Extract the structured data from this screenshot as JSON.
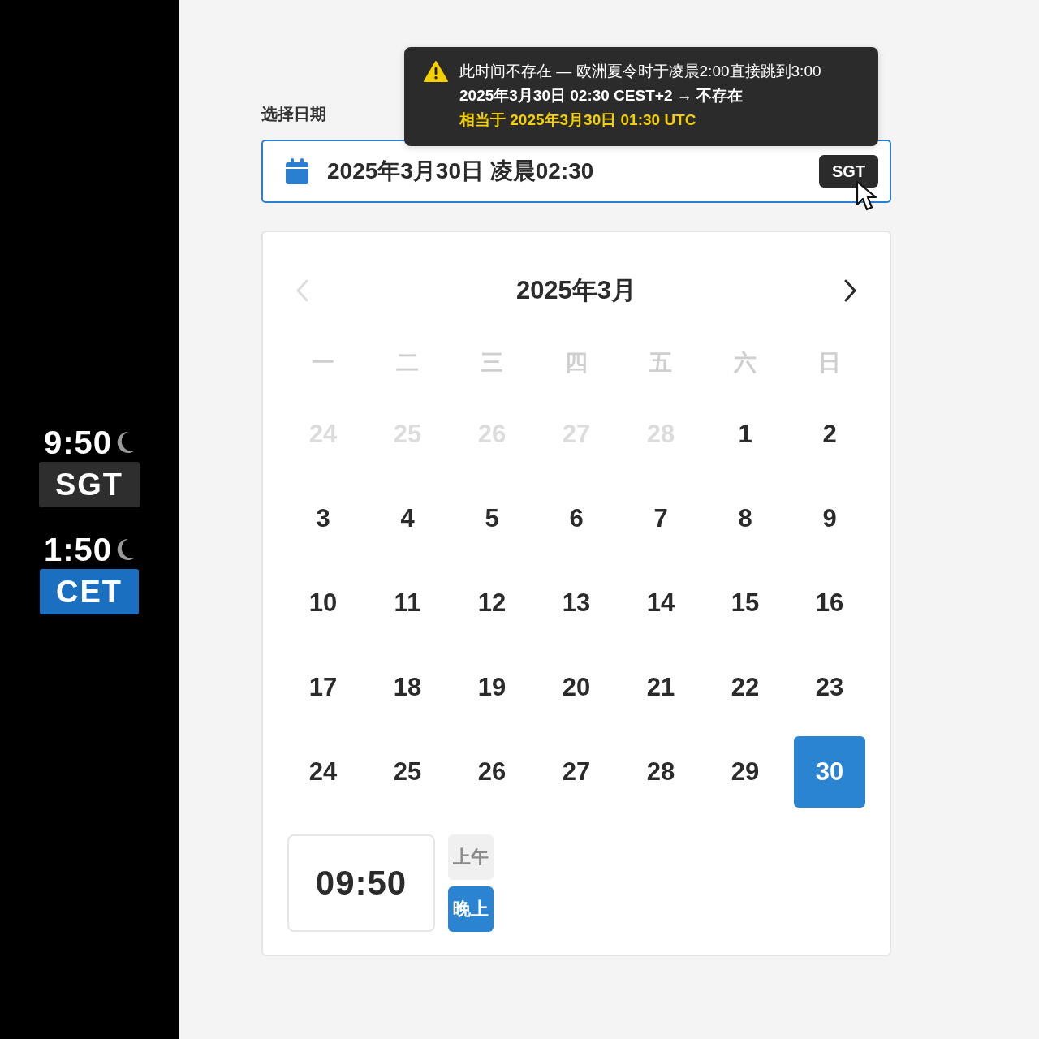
{
  "sidebar": {
    "clocks": [
      {
        "time": "9:50",
        "zone": "SGT",
        "night": true,
        "selected": false
      },
      {
        "time": "1:50",
        "zone": "CET",
        "night": true,
        "selected": true
      }
    ]
  },
  "tooltip": {
    "lines": [
      {
        "kind": "note",
        "text": "此时间不存在 — 欧洲夏令时于凌晨2:00直接跳到3:00"
      },
      {
        "kind": "detail",
        "text": "2025年3月30日 02:30 CEST+2 → 不存在"
      },
      {
        "kind": "highlight",
        "text": "相当于 2025年3月30日 01:30 UTC"
      }
    ]
  },
  "date_field": {
    "label": "选择日期",
    "value": "2025年3月30日 凌晨02:30",
    "zone_button": "SGT"
  },
  "calendar": {
    "title": "2025年3月",
    "prev": {
      "disabled": true
    },
    "next": {
      "disabled": false
    },
    "weekdays": [
      "一",
      "二",
      "三",
      "四",
      "五",
      "六",
      "日"
    ],
    "days": [
      {
        "label": "24",
        "outside": true,
        "selected": false
      },
      {
        "label": "25",
        "outside": true,
        "selected": false
      },
      {
        "label": "26",
        "outside": true,
        "selected": false
      },
      {
        "label": "27",
        "outside": true,
        "selected": false
      },
      {
        "label": "28",
        "outside": true,
        "selected": false
      },
      {
        "label": "1",
        "outside": false,
        "selected": false
      },
      {
        "label": "2",
        "outside": false,
        "selected": false
      },
      {
        "label": "3",
        "outside": false,
        "selected": false
      },
      {
        "label": "4",
        "outside": false,
        "selected": false
      },
      {
        "label": "5",
        "outside": false,
        "selected": false
      },
      {
        "label": "6",
        "outside": false,
        "selected": false
      },
      {
        "label": "7",
        "outside": false,
        "selected": false
      },
      {
        "label": "8",
        "outside": false,
        "selected": false
      },
      {
        "label": "9",
        "outside": false,
        "selected": false
      },
      {
        "label": "10",
        "outside": false,
        "selected": false
      },
      {
        "label": "11",
        "outside": false,
        "selected": false
      },
      {
        "label": "12",
        "outside": false,
        "selected": false
      },
      {
        "label": "13",
        "outside": false,
        "selected": false
      },
      {
        "label": "14",
        "outside": false,
        "selected": false
      },
      {
        "label": "15",
        "outside": false,
        "selected": false
      },
      {
        "label": "16",
        "outside": false,
        "selected": false
      },
      {
        "label": "17",
        "outside": false,
        "selected": false
      },
      {
        "label": "18",
        "outside": false,
        "selected": false
      },
      {
        "label": "19",
        "outside": false,
        "selected": false
      },
      {
        "label": "20",
        "outside": false,
        "selected": false
      },
      {
        "label": "21",
        "outside": false,
        "selected": false
      },
      {
        "label": "22",
        "outside": false,
        "selected": false
      },
      {
        "label": "23",
        "outside": false,
        "selected": false
      },
      {
        "label": "24",
        "outside": false,
        "selected": false
      },
      {
        "label": "25",
        "outside": false,
        "selected": false
      },
      {
        "label": "26",
        "outside": false,
        "selected": false
      },
      {
        "label": "27",
        "outside": false,
        "selected": false
      },
      {
        "label": "28",
        "outside": false,
        "selected": false
      },
      {
        "label": "29",
        "outside": false,
        "selected": false
      },
      {
        "label": "30",
        "outside": false,
        "selected": true
      }
    ]
  },
  "time": {
    "value": "09:50",
    "periods": [
      {
        "label": "上午",
        "selected": false
      },
      {
        "label": "晚上",
        "selected": true
      }
    ]
  }
}
